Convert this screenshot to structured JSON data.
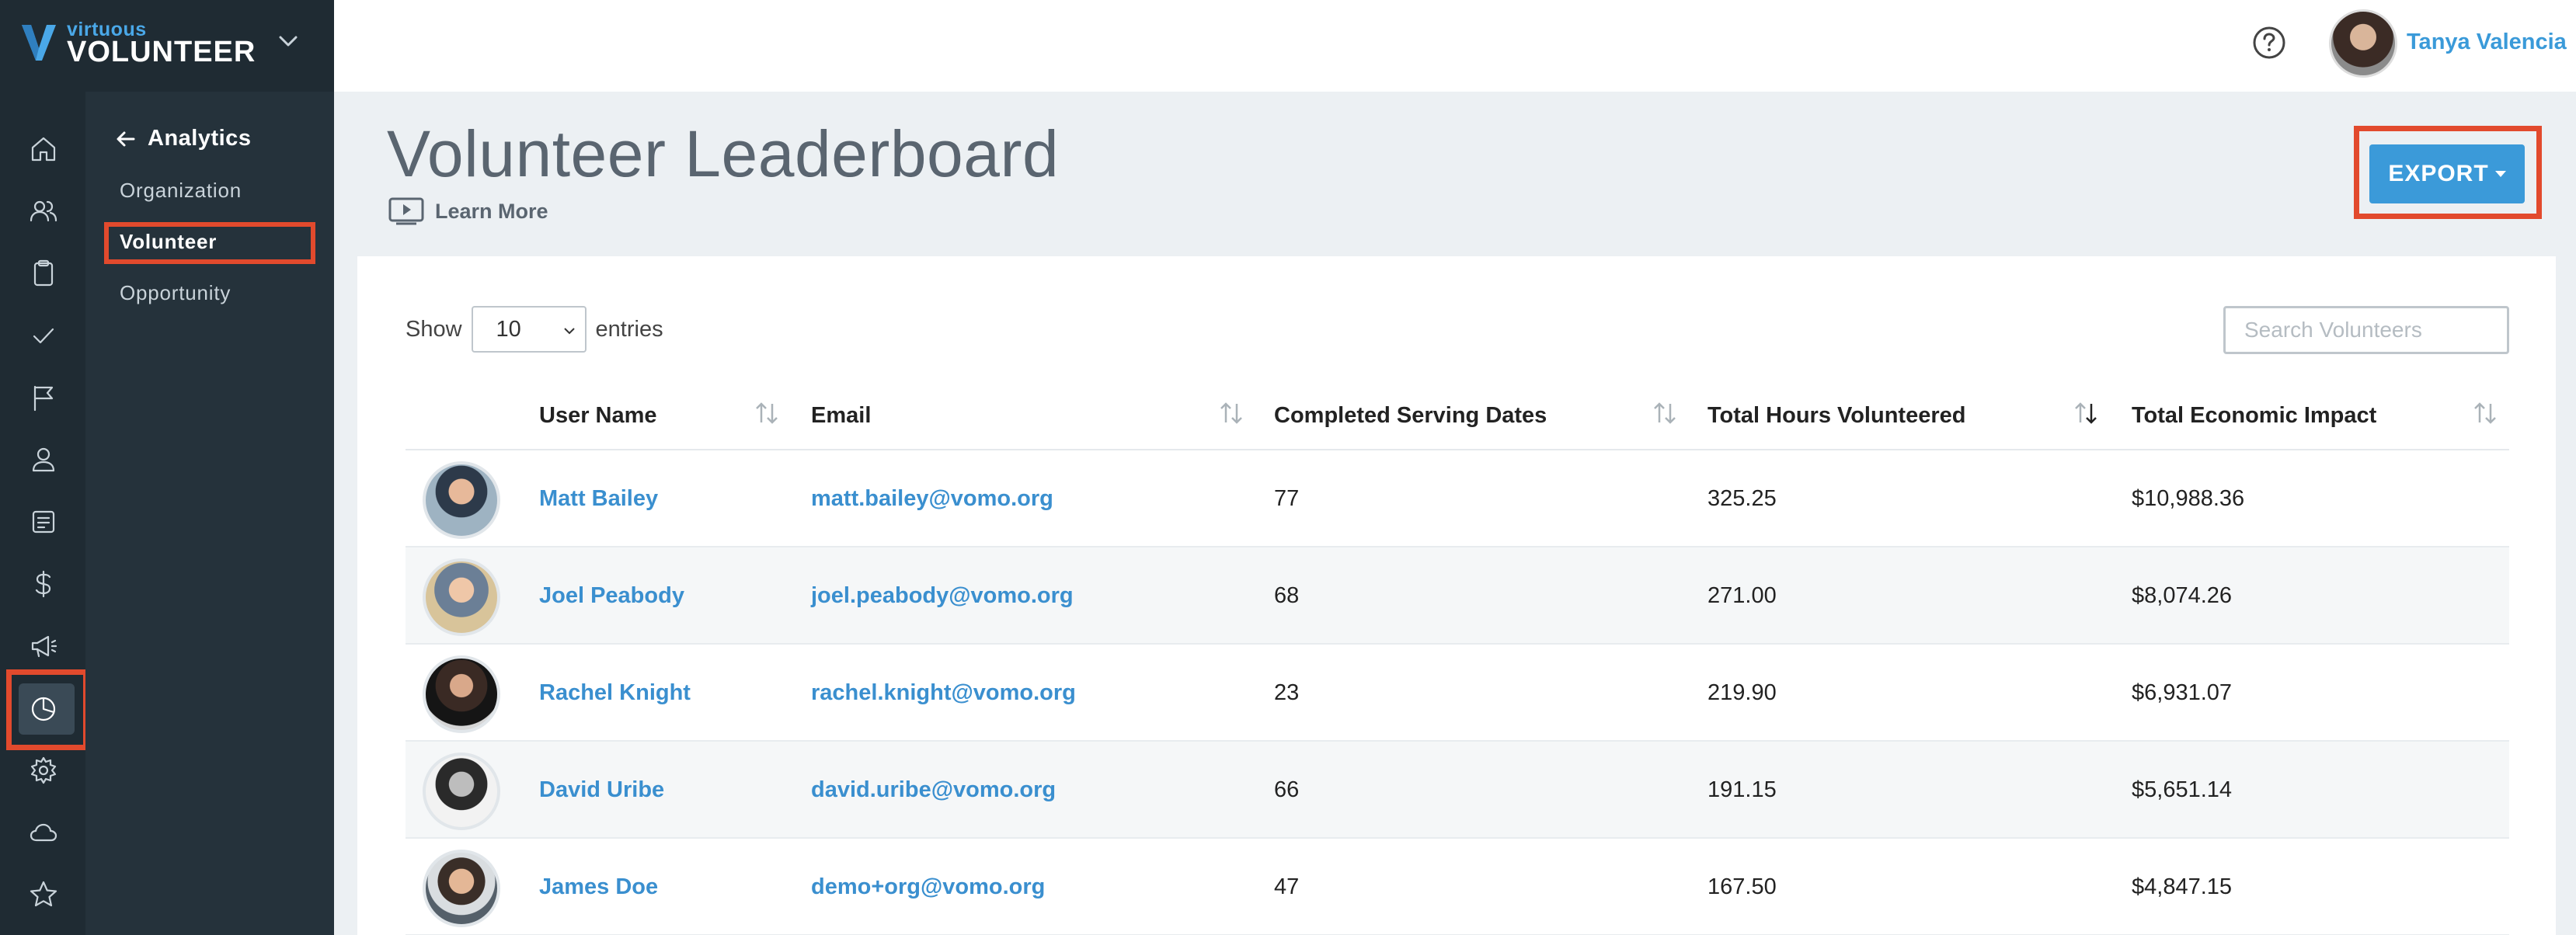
{
  "brand": {
    "small": "virtuous",
    "big": "VOLUNTEER"
  },
  "rail_icons": [
    "home-icon",
    "users-icon",
    "clipboard-icon",
    "check-icon",
    "flag-icon",
    "person-icon",
    "document-icon",
    "dollar-icon",
    "megaphone-icon",
    "pie-chart-icon",
    "gear-icon",
    "cloud-icon",
    "star-icon"
  ],
  "subnav": {
    "title": "Analytics",
    "items": [
      {
        "label": "Organization",
        "active": false
      },
      {
        "label": "Volunteer",
        "active": true
      },
      {
        "label": "Opportunity",
        "active": false
      }
    ]
  },
  "topbar": {
    "user_name": "Tanya Valencia"
  },
  "page": {
    "title": "Volunteer Leaderboard",
    "learn_more": "Learn More",
    "export_label": "EXPORT"
  },
  "table_controls": {
    "show_label": "Show",
    "entries_value": "10",
    "entries_label": "entries",
    "search_placeholder": "Search Volunteers"
  },
  "table": {
    "columns": [
      "User Name",
      "Email",
      "Completed Serving Dates",
      "Total Hours Volunteered",
      "Total Economic Impact"
    ],
    "rows": [
      {
        "name": "Matt Bailey",
        "email": "matt.bailey@vomo.org",
        "dates": "77",
        "hours": "325.25",
        "impact": "$10,988.36"
      },
      {
        "name": "Joel Peabody",
        "email": "joel.peabody@vomo.org",
        "dates": "68",
        "hours": "271.00",
        "impact": "$8,074.26"
      },
      {
        "name": "Rachel Knight",
        "email": "rachel.knight@vomo.org",
        "dates": "23",
        "hours": "219.90",
        "impact": "$6,931.07"
      },
      {
        "name": "David Uribe",
        "email": "david.uribe@vomo.org",
        "dates": "66",
        "hours": "191.15",
        "impact": "$5,651.14"
      },
      {
        "name": "James Doe",
        "email": "demo+org@vomo.org",
        "dates": "47",
        "hours": "167.50",
        "impact": "$4,847.15"
      }
    ]
  },
  "colors": {
    "accent": "#3b9ad9",
    "highlight": "#e24a2d",
    "sidebar": "#1f2b33"
  }
}
